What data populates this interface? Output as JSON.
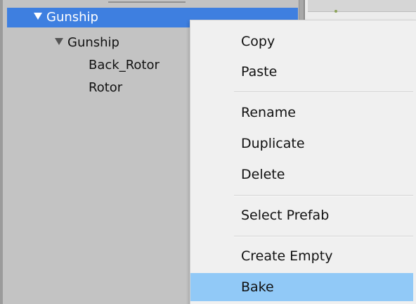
{
  "hierarchy": {
    "items": [
      {
        "label": "Gunship"
      },
      {
        "label": "Gunship"
      },
      {
        "label": "Back_Rotor"
      },
      {
        "label": "Rotor"
      }
    ]
  },
  "context_menu": {
    "groups": [
      {
        "items": [
          {
            "label": "Copy"
          },
          {
            "label": "Paste"
          }
        ]
      },
      {
        "items": [
          {
            "label": "Rename"
          },
          {
            "label": "Duplicate"
          },
          {
            "label": "Delete"
          }
        ]
      },
      {
        "items": [
          {
            "label": "Select Prefab"
          }
        ]
      },
      {
        "items": [
          {
            "label": "Create Empty"
          },
          {
            "label": "Bake"
          }
        ]
      }
    ],
    "highlighted": "Bake"
  },
  "colors": {
    "selection_blue": "#3e7fe0",
    "menu_hover": "#91c9f7",
    "panel_gray": "#c3c3c3",
    "menu_background": "#f0f0f0"
  }
}
